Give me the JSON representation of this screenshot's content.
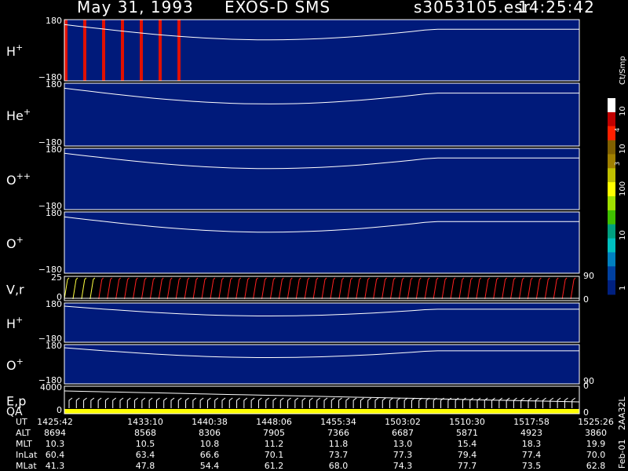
{
  "header": {
    "date": "May 31, 1993",
    "instrument": "EXOS-D SMS",
    "file": "s3053105.esr",
    "time": "14:25:42"
  },
  "panels": [
    {
      "id": "h-plus",
      "label": "H",
      "sup": "+",
      "top_tick": "180",
      "bottom_tick": "−180"
    },
    {
      "id": "he-plus",
      "label": "He",
      "sup": "+",
      "top_tick": "180",
      "bottom_tick": "−180"
    },
    {
      "id": "o-plus-plus",
      "label": "O",
      "sup": "++",
      "top_tick": "180",
      "bottom_tick": "−180"
    },
    {
      "id": "o-plus",
      "label": "O",
      "sup": "+",
      "top_tick": "180",
      "bottom_tick": "−180"
    },
    {
      "id": "vr",
      "label": "V,r",
      "sup": "",
      "top_tick": "25",
      "bottom_tick": "0",
      "right_top": "90",
      "right_bottom": "0"
    },
    {
      "id": "h-plus-2",
      "label": "H",
      "sup": "+",
      "top_tick": "180",
      "bottom_tick": "−180"
    },
    {
      "id": "o-plus-2",
      "label": "O",
      "sup": "+",
      "top_tick": "180",
      "bottom_tick": "−180",
      "right_mid": "90"
    },
    {
      "id": "ep-qa",
      "label": "E,p",
      "label2": "QA",
      "sup": "",
      "top_tick": "4000",
      "bottom_tick": "0",
      "right_top": "0",
      "right_bottom": "0"
    }
  ],
  "colorbar": {
    "unit": "Ct/Smp",
    "ticks": [
      "10",
      "4",
      "10",
      "3",
      "100",
      "10",
      "1"
    ],
    "colors": [
      "#ffffff",
      "#c00000",
      "#ff2000",
      "#806000",
      "#a08000",
      "#c0c000",
      "#ffff00",
      "#a0e000",
      "#40c000",
      "#00a080",
      "#00c0c0",
      "#0080c0",
      "#0040a0",
      "#002080"
    ]
  },
  "side_text": {
    "left": "Feb-01",
    "right": "2AA32L"
  },
  "table": {
    "row_labels": [
      "UT",
      "ALT",
      "MLT",
      "InLat",
      "MLat"
    ],
    "columns": [
      [
        "1425:42",
        "8694",
        "10.3",
        "60.4",
        "41.3"
      ],
      [
        "1433:10",
        "8568",
        "10.5",
        "63.4",
        "47.8"
      ],
      [
        "1440:38",
        "8306",
        "10.8",
        "66.6",
        "54.4"
      ],
      [
        "1448:06",
        "7905",
        "11.2",
        "70.1",
        "61.2"
      ],
      [
        "1455:34",
        "7366",
        "11.8",
        "73.7",
        "68.0"
      ],
      [
        "1503:02",
        "6687",
        "13.0",
        "77.3",
        "74.3"
      ],
      [
        "1510:30",
        "5871",
        "15.4",
        "79.4",
        "77.7"
      ],
      [
        "1517:58",
        "4923",
        "18.3",
        "77.4",
        "73.5"
      ],
      [
        "1525:26",
        "3860",
        "19.9",
        "70.0",
        "62.8"
      ]
    ]
  },
  "chart_data": {
    "type": "heatmap",
    "x_ticks": [
      "1425:42",
      "1433:10",
      "1440:38",
      "1448:06",
      "1455:34",
      "1503:02",
      "1510:30",
      "1517:58",
      "1525:26"
    ],
    "y_range": [
      -180,
      180
    ],
    "colorscale_unit": "Ct/Smp",
    "colorscale_range": [
      1,
      10000
    ],
    "colorscale_log": true,
    "series": [
      {
        "name": "H+"
      },
      {
        "name": "He+"
      },
      {
        "name": "O++"
      },
      {
        "name": "O+"
      },
      {
        "name": "V,r"
      },
      {
        "name": "H+"
      },
      {
        "name": "O+"
      },
      {
        "name": "E,p"
      }
    ]
  }
}
